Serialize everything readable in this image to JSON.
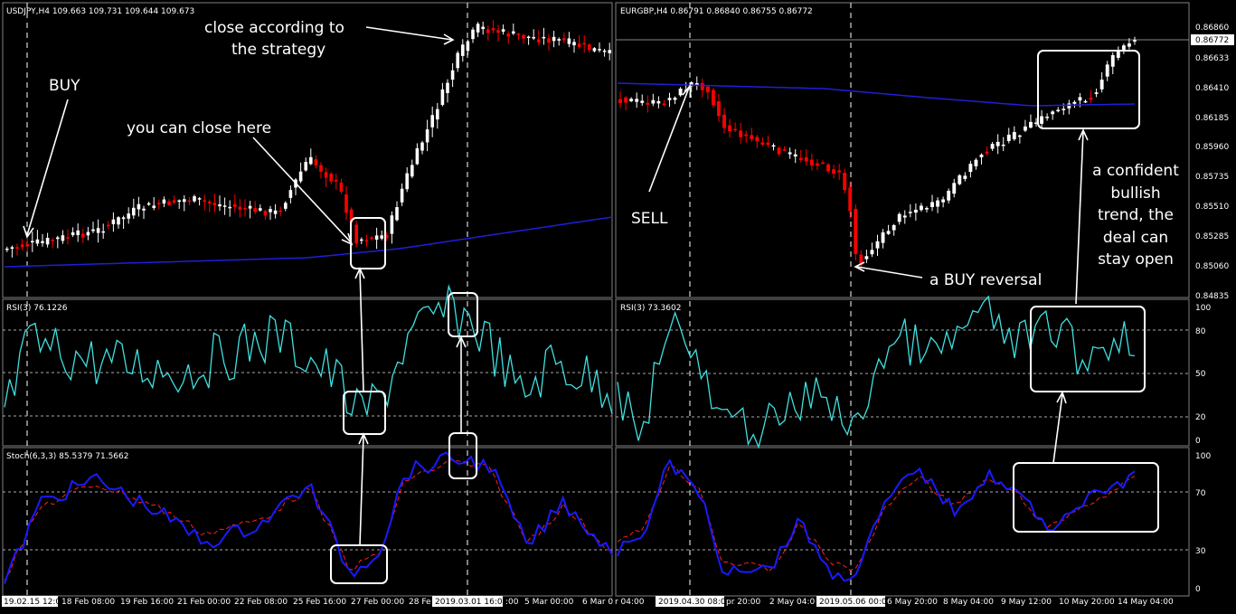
{
  "left_chart": {
    "header": "USDJPY,H4  109.663 109.731 109.644 109.673",
    "rsi_label": "RSI(3) 76.1226",
    "stoch_label": "Stoch(6,3,3) 85.5379 71.5662",
    "time_labels": [
      "19.02.15 12:00",
      "18 Feb 08:00",
      "19 Feb 16:00",
      "21 Feb 00:00",
      "22 Feb 08:00",
      "25 Feb 16:00",
      "27 Feb 00:00",
      "28 Fe",
      "2019.03.01 16:00",
      ":00",
      "5 Mar 00:00",
      "6 Mar 0"
    ],
    "annotations": {
      "buy": "BUY",
      "close_here": "you can close here",
      "close_strategy_1": "close according to",
      "close_strategy_2": "the strategy"
    }
  },
  "right_chart": {
    "header": "EURGBP,H4  0.86791 0.86840 0.86755 0.86772",
    "rsi_label": "RSI(3) 73.3602",
    "price_labels": [
      "0.86860",
      "0.86633",
      "0.86410",
      "0.86185",
      "0.85960",
      "0.85735",
      "0.85510",
      "0.85285",
      "0.85060",
      "0.84835"
    ],
    "current_price": "0.86772",
    "rsi_levels": [
      "100",
      "80",
      "50",
      "20",
      "0"
    ],
    "stoch_levels": [
      "100",
      "70",
      "30",
      "0"
    ],
    "time_labels": [
      "r 04:00",
      "2019.04.30 08:00",
      "pr 20:00",
      "2 May 04:0",
      "2019.05.06 00:00",
      "6 May 20:00",
      "8 May 04:00",
      "9 May 12:00",
      "10 May 20:00",
      "14 May 04:00"
    ],
    "annotations": {
      "sell": "SELL",
      "buy_reversal": "a BUY reversal",
      "confident_1": "a confident",
      "confident_2": "bullish",
      "confident_3": "trend, the",
      "confident_4": "deal can",
      "confident_5": "stay open"
    }
  },
  "colors": {
    "bull": "#ffffff",
    "bear": "#ff0000",
    "ma": "#1f1fd8",
    "rsi": "#40e0e0",
    "stoch_main": "#1a1aff",
    "stoch_signal": "#ff2020",
    "frame": "#ffffff",
    "annotation": "#ffffff"
  }
}
